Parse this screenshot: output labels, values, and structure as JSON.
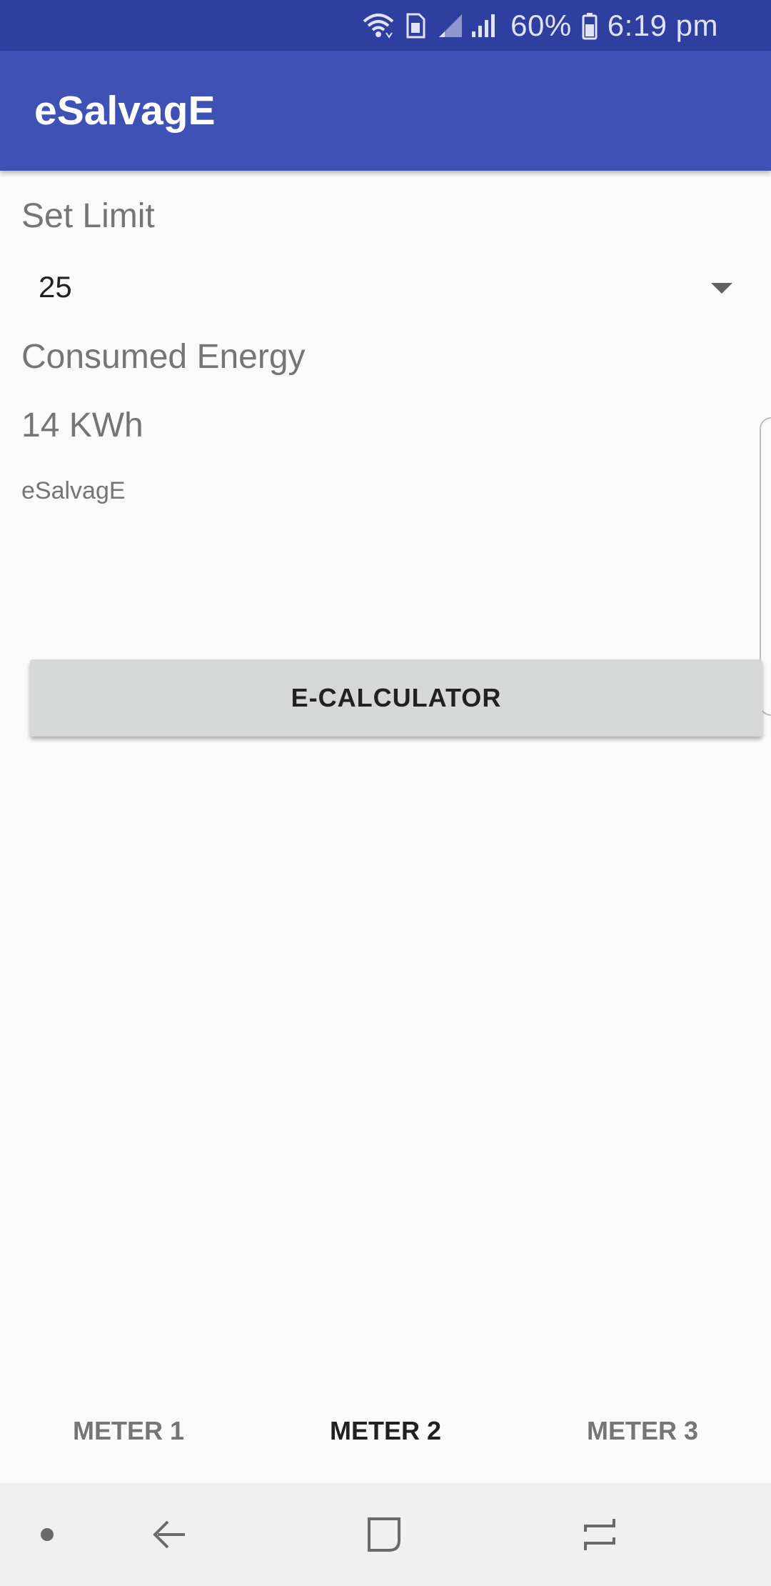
{
  "status_bar": {
    "battery": "60%",
    "time": "6:19 pm",
    "icons": [
      "wifi-icon",
      "sim-icon",
      "signal-icon",
      "battery-icon"
    ]
  },
  "app_bar": {
    "title": "eSalvagE"
  },
  "form": {
    "set_limit_label": "Set Limit",
    "limit_value": "25",
    "consumed_label": "Consumed Energy",
    "consumed_value": "14 KWh",
    "brand_text": "eSalvagE",
    "calculator_button": "E-CALCULATOR"
  },
  "tabs": [
    {
      "label": "METER 1",
      "active": false
    },
    {
      "label": "METER 2",
      "active": true
    },
    {
      "label": "METER 3",
      "active": false
    }
  ],
  "nav_bar": {
    "icons": [
      "dot-icon",
      "back-icon",
      "home-icon",
      "recent-apps-icon"
    ]
  },
  "colors": {
    "status_bar": "#2f3fa0",
    "app_bar": "#3f51b5",
    "button_bg": "#d6d7d7",
    "background": "#fafafa"
  }
}
